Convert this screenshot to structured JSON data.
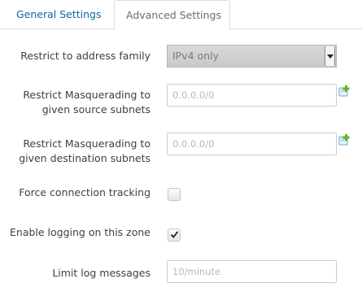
{
  "tabs": [
    {
      "label": "General Settings",
      "active": false
    },
    {
      "label": "Advanced Settings",
      "active": true
    }
  ],
  "fields": {
    "address_family": {
      "label": "Restrict to address family",
      "value": "IPv4 only"
    },
    "masq_src": {
      "label_line1": "Restrict Masquerading to",
      "label_line2": "given source subnets",
      "placeholder": "0.0.0.0/0"
    },
    "masq_dest": {
      "label_line1": "Restrict Masquerading to",
      "label_line2": "given destination subnets",
      "placeholder": "0.0.0.0/0"
    },
    "conntrack": {
      "label": "Force connection tracking",
      "checked": false
    },
    "logging": {
      "label": "Enable logging on this zone",
      "checked": true
    },
    "log_limit": {
      "label": "Limit log messages",
      "placeholder": "10/minute"
    }
  },
  "icons": {
    "add": "add-entry-icon",
    "dropdown": "chevron-down-icon",
    "check": "checkmark-icon"
  },
  "colors": {
    "tab_active_link": "#0a69a4",
    "select_bg": "#d0d0d0",
    "add_icon_green": "#5fb32b",
    "add_icon_blue": "#6aa8d8"
  }
}
